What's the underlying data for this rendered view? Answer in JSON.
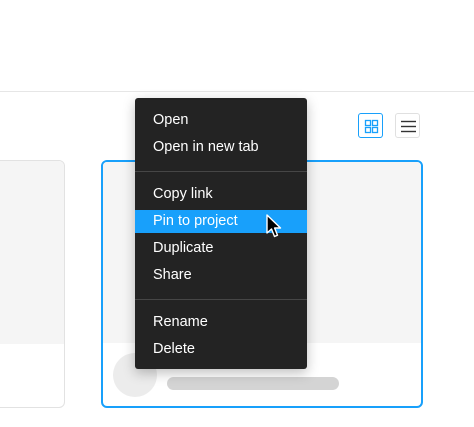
{
  "view_toggle": {
    "grid_icon": "grid-view-icon",
    "list_icon": "list-view-icon",
    "active": "grid",
    "accent_color": "#18a0fb"
  },
  "context_menu": {
    "groups": [
      [
        {
          "label": "Open"
        },
        {
          "label": "Open in new tab"
        }
      ],
      [
        {
          "label": "Copy link"
        },
        {
          "label": "Pin to project",
          "highlighted": true
        },
        {
          "label": "Duplicate"
        },
        {
          "label": "Share"
        }
      ],
      [
        {
          "label": "Rename"
        },
        {
          "label": "Delete"
        }
      ]
    ],
    "background_color": "#232323",
    "highlight_color": "#18a0fb"
  },
  "cursor": {
    "icon": "arrow-pointer-icon"
  },
  "cards": {
    "selected_border_color": "#18a0fb"
  }
}
